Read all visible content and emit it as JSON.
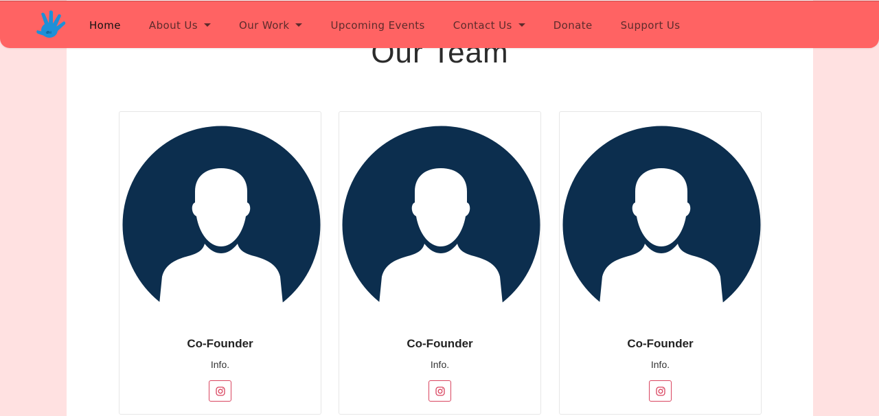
{
  "colors": {
    "navbar_bg": "#ff6363",
    "page_bg": "#ffe1e1",
    "avatar_bg": "#0c2e4e",
    "social_accent": "#d9435e"
  },
  "navbar": {
    "logo_icon": "hand-logo-icon",
    "items": [
      {
        "label": "Home",
        "active": true,
        "dropdown": false
      },
      {
        "label": "About Us",
        "active": false,
        "dropdown": true
      },
      {
        "label": "Our Work",
        "active": false,
        "dropdown": true
      },
      {
        "label": "Upcoming Events",
        "active": false,
        "dropdown": false
      },
      {
        "label": "Contact Us",
        "active": false,
        "dropdown": true
      },
      {
        "label": "Donate",
        "active": false,
        "dropdown": false
      },
      {
        "label": "Support Us",
        "active": false,
        "dropdown": false
      }
    ]
  },
  "team": {
    "title": "Our Team",
    "members": [
      {
        "role": "Co-Founder",
        "info": "Info.",
        "avatar_icon": "person-avatar-icon",
        "social_icon": "instagram-icon"
      },
      {
        "role": "Co-Founder",
        "info": "Info.",
        "avatar_icon": "person-avatar-icon",
        "social_icon": "instagram-icon"
      },
      {
        "role": "Co-Founder",
        "info": "Info.",
        "avatar_icon": "person-avatar-icon",
        "social_icon": "instagram-icon"
      }
    ]
  }
}
